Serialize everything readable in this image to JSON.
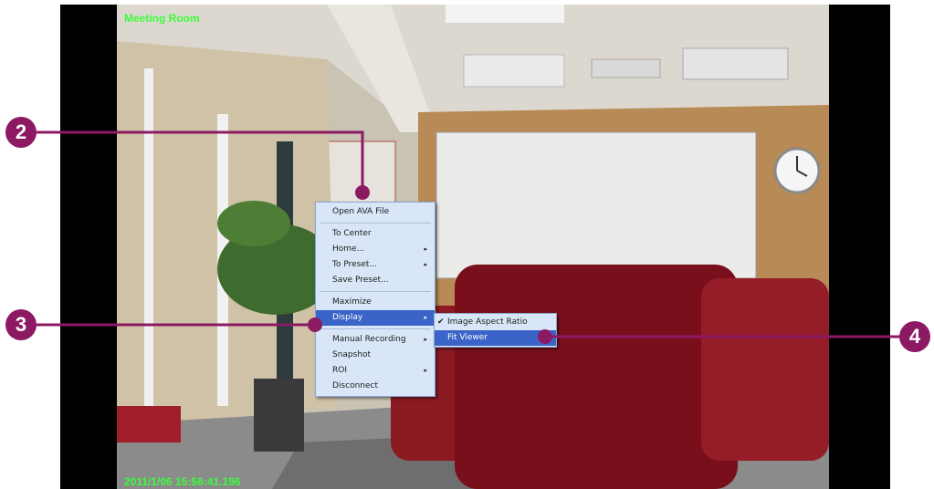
{
  "viewer": {
    "camera_name": "Meeting Room",
    "timestamp": "2011/1/06 15:56:41.196"
  },
  "context_menu": {
    "items": [
      {
        "label": "Open AVA File"
      },
      {
        "label": "To Center"
      },
      {
        "label": "Home...",
        "submenu": true
      },
      {
        "label": "To Preset...",
        "submenu": true
      },
      {
        "label": "Save Preset..."
      },
      {
        "label": "Maximize"
      },
      {
        "label": "Display",
        "submenu": true,
        "highlighted": true
      },
      {
        "label": "Manual Recording",
        "submenu": true
      },
      {
        "label": "Snapshot"
      },
      {
        "label": "ROI",
        "submenu": true
      },
      {
        "label": "Disconnect"
      }
    ]
  },
  "display_submenu": {
    "items": [
      {
        "label": "Image Aspect Ratio",
        "checked": true
      },
      {
        "label": "Fit Viewer",
        "highlighted": true
      }
    ]
  },
  "callouts": {
    "c2": "2",
    "c3": "3",
    "c4": "4",
    "color": "#8c1a63"
  },
  "icons": {
    "submenu_arrow": "▸",
    "check_mark": "✔"
  }
}
